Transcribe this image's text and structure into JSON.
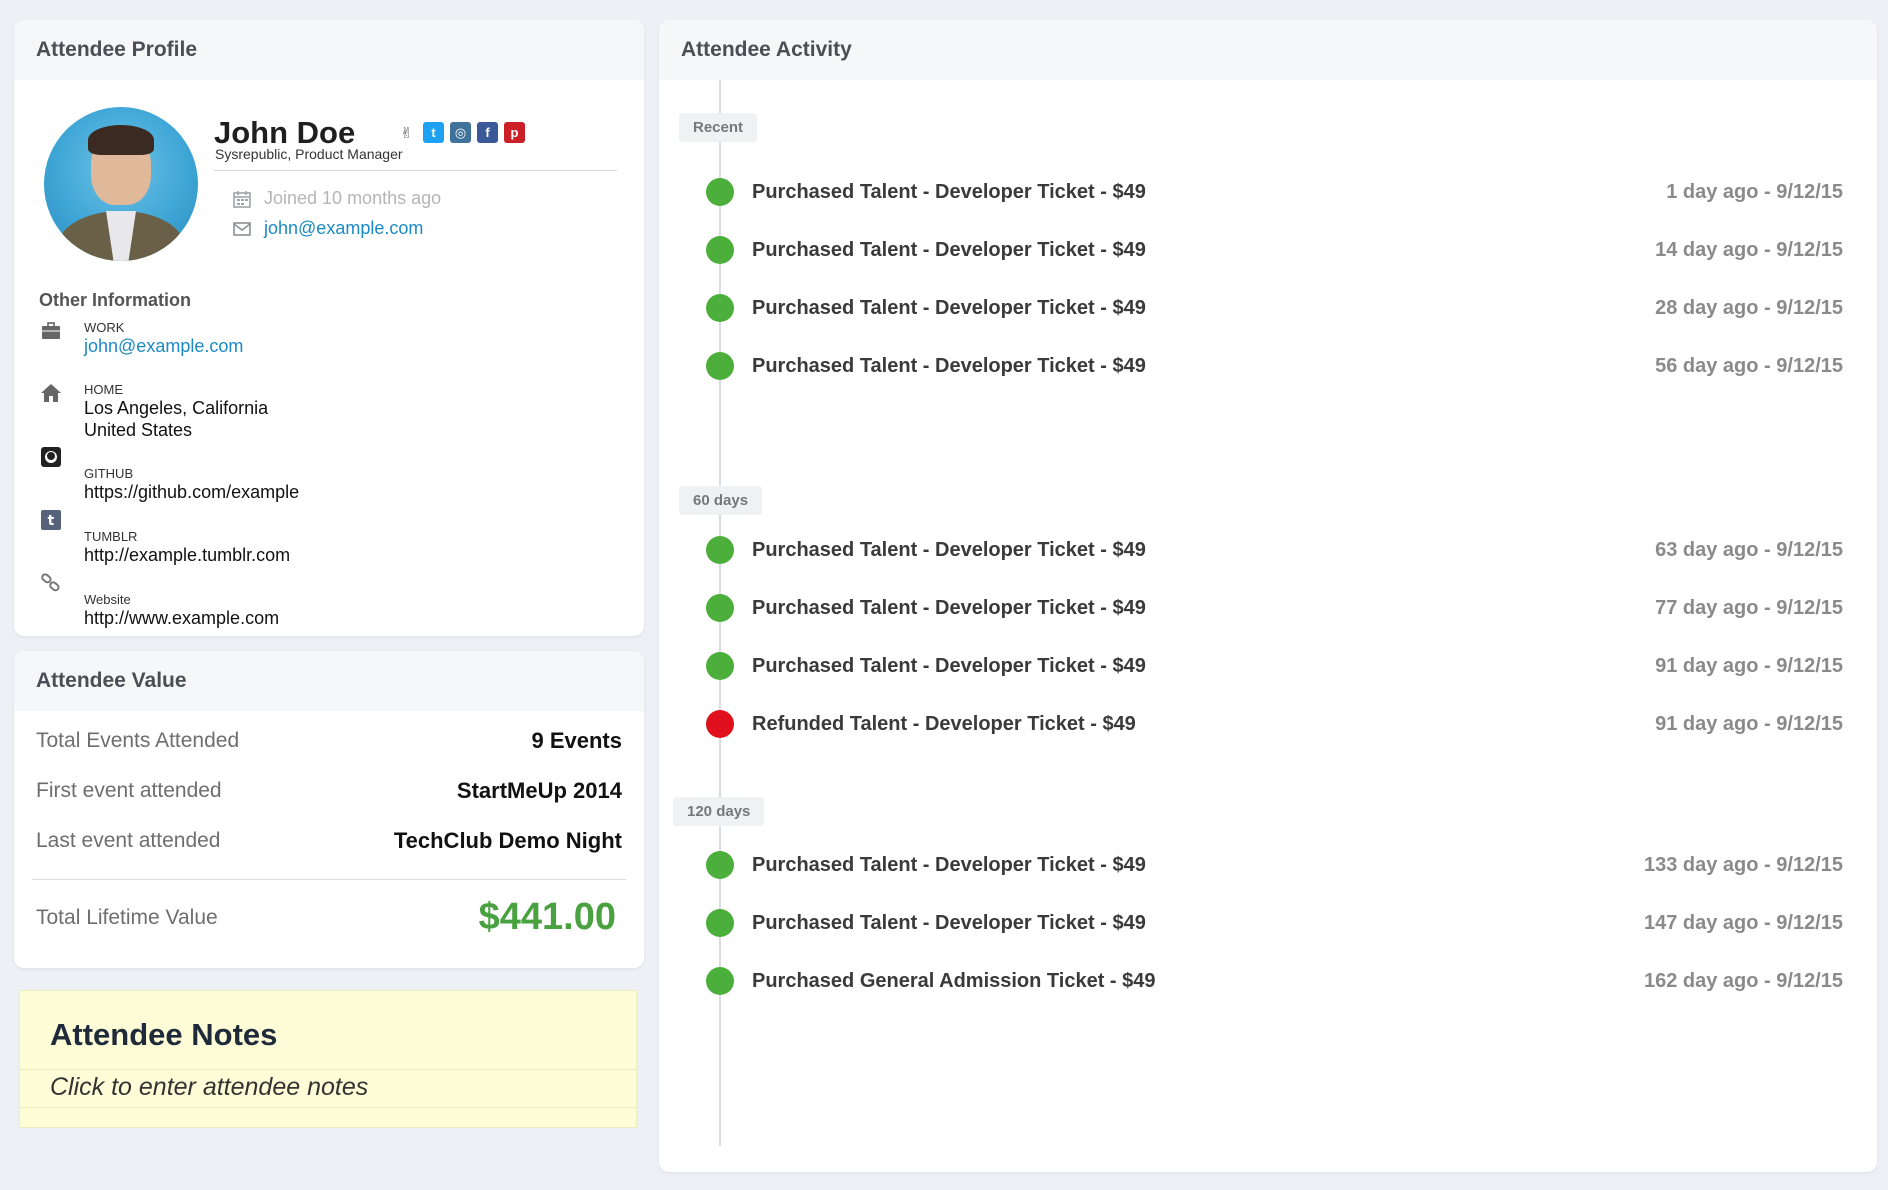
{
  "profile": {
    "header": "Attendee Profile",
    "name": "John Doe",
    "subtitle": "Sysrepublic, Product Manager",
    "joined": "Joined 10 months ago",
    "email": "john@example.com",
    "social_icons": [
      "angellist-icon",
      "twitter-icon",
      "instagram-icon",
      "facebook-icon",
      "pinterest-icon"
    ],
    "other_title": "Other Information",
    "work": {
      "label": "WORK",
      "value": "john@example.com"
    },
    "home": {
      "label": "HOME",
      "line1": "Los Angeles, California",
      "line2": "United States"
    },
    "github": {
      "label": "GITHUB",
      "value": "https://github.com/example"
    },
    "tumblr": {
      "label": "TUMBLR",
      "value": "http://example.tumblr.com"
    },
    "website": {
      "label": "Website",
      "value": "http://www.example.com"
    }
  },
  "value": {
    "header": "Attendee Value",
    "rows": [
      {
        "label": "Total Events Attended",
        "value": "9 Events"
      },
      {
        "label": "First event attended",
        "value": "StartMeUp 2014"
      },
      {
        "label": "Last event attended",
        "value": "TechClub Demo Night"
      }
    ],
    "lifetime": {
      "label": "Total Lifetime Value",
      "value": "$441.00"
    }
  },
  "notes": {
    "title": "Attendee Notes",
    "placeholder": "Click to enter attendee notes"
  },
  "activity": {
    "header": "Attendee Activity",
    "groups": [
      {
        "label": "Recent",
        "events": [
          {
            "title": "Purchased Talent - Developer Ticket - $49",
            "time": "1 day ago - 9/12/15",
            "status": "purchase"
          },
          {
            "title": "Purchased Talent - Developer Ticket - $49",
            "time": "14 day ago - 9/12/15",
            "status": "purchase"
          },
          {
            "title": "Purchased Talent - Developer Ticket - $49",
            "time": "28 day ago - 9/12/15",
            "status": "purchase"
          },
          {
            "title": "Purchased Talent - Developer Ticket - $49",
            "time": "56 day ago - 9/12/15",
            "status": "purchase"
          }
        ]
      },
      {
        "label": "60 days",
        "events": [
          {
            "title": "Purchased Talent - Developer Ticket - $49",
            "time": "63 day ago - 9/12/15",
            "status": "purchase"
          },
          {
            "title": "Purchased Talent - Developer Ticket - $49",
            "time": "77 day ago - 9/12/15",
            "status": "purchase"
          },
          {
            "title": "Purchased Talent - Developer Ticket - $49",
            "time": "91 day ago - 9/12/15",
            "status": "purchase"
          },
          {
            "title": "Refunded Talent - Developer Ticket - $49",
            "time": "91 day ago - 9/12/15",
            "status": "refund"
          }
        ]
      },
      {
        "label": "120 days",
        "events": [
          {
            "title": "Purchased Talent - Developer Ticket - $49",
            "time": "133 day ago - 9/12/15",
            "status": "purchase"
          },
          {
            "title": "Purchased Talent - Developer Ticket - $49",
            "time": "147 day ago - 9/12/15",
            "status": "purchase"
          },
          {
            "title": "Purchased General Admission Ticket - $49",
            "time": "162 day ago - 9/12/15",
            "status": "purchase"
          }
        ]
      }
    ]
  },
  "colors": {
    "purchase": "#4caf3b",
    "refund": "#e0101f",
    "lifetime": "#4aa140",
    "link": "#1b8ac4"
  }
}
